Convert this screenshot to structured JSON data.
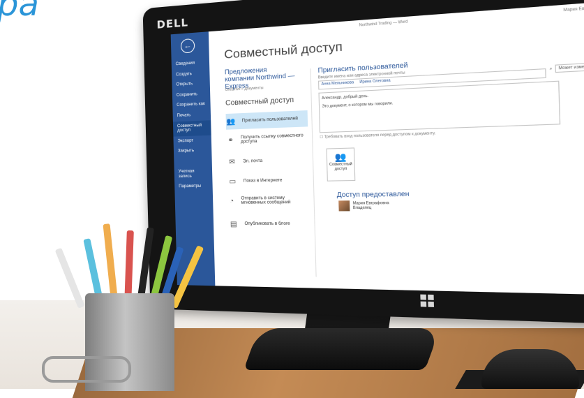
{
  "caption": "pa",
  "monitor": {
    "brand": "DELL",
    "window": {
      "doc_title": "Northwind Trading — Word",
      "user": "Мария Евграфовна",
      "controls": "? – ❐ ✕"
    },
    "sidebar": {
      "items": [
        "Сведения",
        "Создать",
        "Открыть",
        "Сохранить",
        "Сохранить как",
        "Печать",
        "Совместный доступ",
        "Экспорт",
        "Закрыть",
        "Учетная запись",
        "Параметры"
      ],
      "active_index": 6
    },
    "page": {
      "title": "Совместный доступ",
      "doc_name": "Предложения компании Northwind — Express",
      "doc_path": "OneDrive » Документы",
      "share_heading": "Совместный доступ",
      "options": [
        {
          "icon": "people-icon",
          "label": "Пригласить пользователей"
        },
        {
          "icon": "link-icon",
          "label": "Получить ссылку совместного доступа"
        },
        {
          "icon": "email-icon",
          "label": "Эл. почта"
        },
        {
          "icon": "present-icon",
          "label": "Показ в Интернете"
        },
        {
          "icon": "meeting-icon",
          "label": "Отправить в систему мгновенных сообщений"
        },
        {
          "icon": "blog-icon",
          "label": "Опубликовать в блоге"
        }
      ],
      "invite": {
        "heading": "Пригласить пользователей",
        "subtitle": "Введите имена или адреса электронной почты",
        "chips": [
          "Анна Мельникова",
          "Ирина Олеговна"
        ],
        "permission_label": "Может изменять",
        "message_lines": [
          "Александр, добрый день.",
          "Это документ, о котором мы говорили."
        ],
        "checkbox_label": "Требовать вход пользователя перед доступом к документу.",
        "share_button": "Совместный доступ"
      },
      "access": {
        "heading": "Доступ предоставлен",
        "person_name": "Мария Евграфовна",
        "person_role": "Владелец"
      }
    }
  }
}
